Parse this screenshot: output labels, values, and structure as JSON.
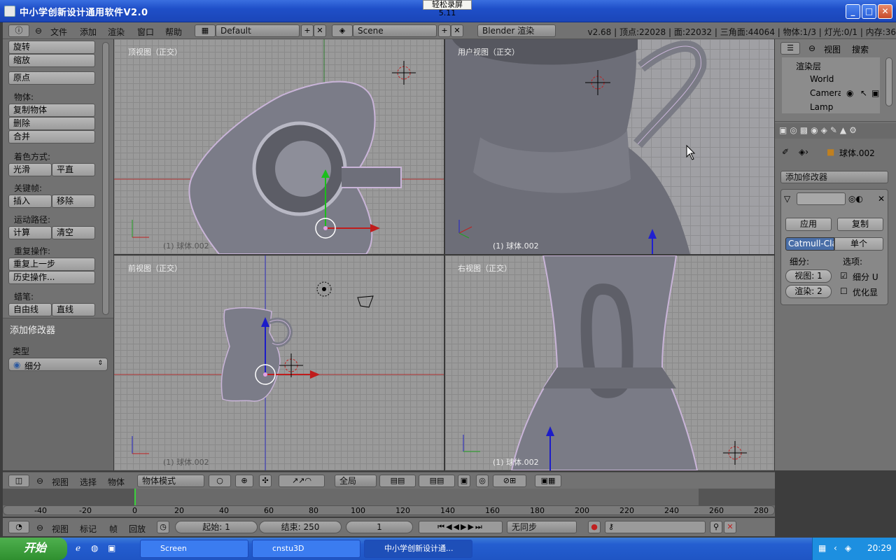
{
  "window": {
    "title": "中小学创新设计通用软件V2.0",
    "recorder_badge": "轻松录屏5.11"
  },
  "menu": {
    "items": [
      "文件",
      "添加",
      "渲染",
      "窗口",
      "帮助"
    ],
    "layout_value": "Default",
    "scene_value": "Scene",
    "engine_value": "Blender 渲染",
    "stats": "v2.68 | 顶点:22028 | 面:22032 | 三角面:44064 | 物体:1/3 | 灯光:0/1 | 内存:36"
  },
  "left_panel": {
    "transform": [
      "旋转",
      "缩放"
    ],
    "origin": "原点",
    "object_label": "物体:",
    "object_buttons": [
      "复制物体",
      "删除",
      "合并"
    ],
    "shading_label": "着色方式:",
    "shading_buttons": [
      "光滑",
      "平直"
    ],
    "keyframe_label": "关键帧:",
    "keyframe_buttons": [
      "插入",
      "移除"
    ],
    "motion_label": "运动路径:",
    "motion_buttons": [
      "计算",
      "清空"
    ],
    "repeat_label": "重复操作:",
    "repeat_buttons": [
      "重复上一步",
      "历史操作..."
    ],
    "grease_label": "蜡笔:",
    "grease_buttons": [
      "自由线",
      "直线"
    ],
    "operator_title": "添加修改器",
    "type_label": "类型",
    "type_value": "细分"
  },
  "viewports": {
    "top": {
      "label": "顶视图（正交）",
      "name": "(1) 球体.002"
    },
    "user": {
      "label": "用户视图（正交）",
      "name": "(1) 球体.002"
    },
    "front": {
      "label": "前视图（正交）",
      "name": "(1) 球体.002"
    },
    "right": {
      "label": "右视图（正交）",
      "name": "(1) 球体.002"
    }
  },
  "right_panel": {
    "outliner_menu": [
      "视图",
      "搜索"
    ],
    "outliner_items": [
      "渲染层",
      "World",
      "Camera",
      "Lamp"
    ],
    "object_name": "球体.002",
    "add_modifier": "添加修改器",
    "apply": "应用",
    "copy": "复制",
    "algo": "Catmull-Clark",
    "simple": "单个",
    "subdiv_label": "细分:",
    "options_label": "选项:",
    "view_value": "视图: 1",
    "render_value": "渲染: 2",
    "opt1": "细分 U",
    "opt2": "优化显"
  },
  "bottom_bar": {
    "items": [
      "视图",
      "选择",
      "物体"
    ],
    "mode": "物体模式",
    "pivot": "全局"
  },
  "timeline": {
    "ticks": [
      "-40",
      "-20",
      "0",
      "20",
      "40",
      "60",
      "80",
      "100",
      "120",
      "140",
      "160",
      "180",
      "200",
      "220",
      "240",
      "260",
      "280"
    ]
  },
  "playbar": {
    "items": [
      "视图",
      "标记",
      "帧",
      "回放"
    ],
    "start": "起始: 1",
    "end": "结束: 250",
    "current": "1",
    "sync": "无同步"
  },
  "taskbar": {
    "start": "开始",
    "tasks": [
      "Screen",
      "cnstu3D",
      "中小学创新设计通..."
    ],
    "clock": "20:29"
  }
}
